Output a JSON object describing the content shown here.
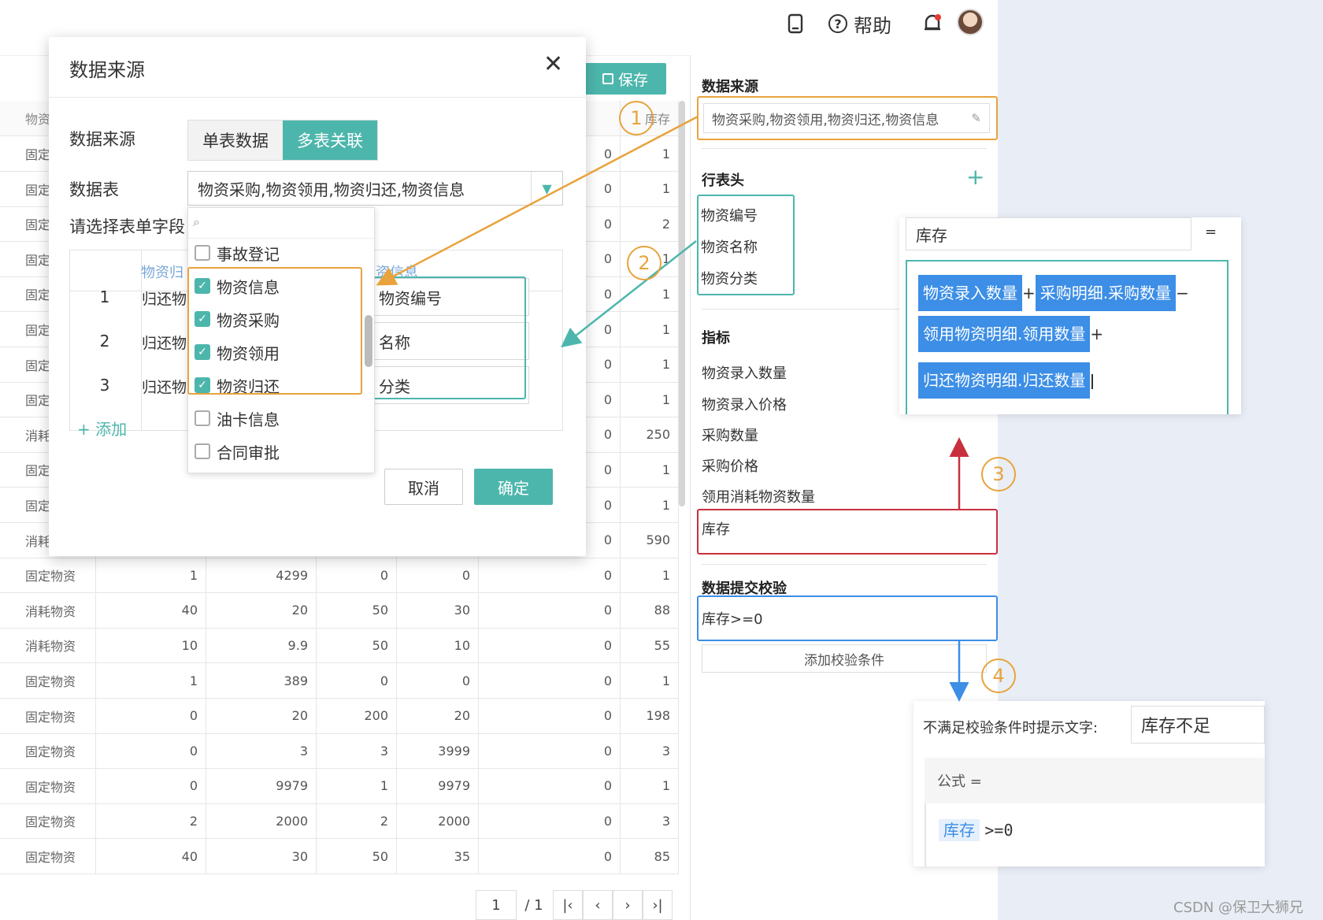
{
  "topbar": {
    "help_label": "帮助"
  },
  "toolbar": {
    "save_label": "保存"
  },
  "table": {
    "header": [
      "物资",
      "库存"
    ],
    "rows": [
      {
        "type": "固定",
        "v1": "",
        "v2": "",
        "v3": "",
        "v4": "",
        "v5": "0",
        "stock": "1"
      },
      {
        "type": "固定",
        "v1": "",
        "v2": "",
        "v3": "",
        "v4": "",
        "v5": "0",
        "stock": "1"
      },
      {
        "type": "固定",
        "v1": "",
        "v2": "",
        "v3": "",
        "v4": "",
        "v5": "0",
        "stock": "2"
      },
      {
        "type": "固定",
        "v1": "",
        "v2": "",
        "v3": "",
        "v4": "",
        "v5": "0",
        "stock": "1"
      },
      {
        "type": "固定",
        "v1": "",
        "v2": "",
        "v3": "",
        "v4": "",
        "v5": "0",
        "stock": "1"
      },
      {
        "type": "固定",
        "v1": "",
        "v2": "",
        "v3": "",
        "v4": "",
        "v5": "0",
        "stock": "1"
      },
      {
        "type": "固定",
        "v1": "",
        "v2": "",
        "v3": "",
        "v4": "",
        "v5": "0",
        "stock": "1"
      },
      {
        "type": "固定",
        "v1": "",
        "v2": "",
        "v3": "",
        "v4": "",
        "v5": "0",
        "stock": "1"
      },
      {
        "type": "消耗",
        "v1": "",
        "v2": "",
        "v3": "",
        "v4": "",
        "v5": "0",
        "stock": "250"
      },
      {
        "type": "固定",
        "v1": "",
        "v2": "",
        "v3": "",
        "v4": "",
        "v5": "0",
        "stock": "1"
      },
      {
        "type": "固定",
        "v1": "",
        "v2": "",
        "v3": "",
        "v4": "",
        "v5": "0",
        "stock": "1"
      },
      {
        "type": "消耗",
        "v1": "",
        "v2": "",
        "v3": "",
        "v4": "",
        "v5": "0",
        "stock": "590"
      },
      {
        "type": "固定物资",
        "v1": "1",
        "v2": "4299",
        "v3": "0",
        "v4": "0",
        "v5": "0",
        "stock": "1"
      },
      {
        "type": "消耗物资",
        "v1": "40",
        "v2": "20",
        "v3": "50",
        "v4": "30",
        "v5": "0",
        "stock": "88"
      },
      {
        "type": "消耗物资",
        "v1": "10",
        "v2": "9.9",
        "v3": "50",
        "v4": "10",
        "v5": "0",
        "stock": "55"
      },
      {
        "type": "固定物资",
        "v1": "1",
        "v2": "389",
        "v3": "0",
        "v4": "0",
        "v5": "0",
        "stock": "1"
      },
      {
        "type": "固定物资",
        "v1": "0",
        "v2": "20",
        "v3": "200",
        "v4": "20",
        "v5": "0",
        "stock": "198"
      },
      {
        "type": "固定物资",
        "v1": "0",
        "v2": "3",
        "v3": "3",
        "v4": "3999",
        "v5": "0",
        "stock": "3"
      },
      {
        "type": "固定物资",
        "v1": "0",
        "v2": "9979",
        "v3": "1",
        "v4": "9979",
        "v5": "0",
        "stock": "1"
      },
      {
        "type": "固定物资",
        "v1": "2",
        "v2": "2000",
        "v3": "2",
        "v4": "2000",
        "v5": "0",
        "stock": "3"
      },
      {
        "type": "固定物资",
        "v1": "40",
        "v2": "30",
        "v3": "50",
        "v4": "35",
        "v5": "0",
        "stock": "85"
      }
    ]
  },
  "pager": {
    "page": "1",
    "total": "/ 1"
  },
  "right_panel": {
    "datasource_title": "数据来源",
    "datasource_value": "物资采购,物资领用,物资归还,物资信息",
    "row_header_title": "行表头",
    "row_headers": [
      "物资编号",
      "物资名称",
      "物资分类"
    ],
    "metrics_title": "指标",
    "metrics": [
      "物资录入数量",
      "物资录入价格",
      "采购数量",
      "采购价格",
      "领用消耗物资数量",
      "库存"
    ],
    "validation_title": "数据提交校验",
    "validation_rule": "库存>=0",
    "add_validation_label": "添加校验条件"
  },
  "dialog": {
    "title": "数据来源",
    "source_label": "数据来源",
    "seg_single": "单表数据",
    "seg_multi": "多表关联",
    "table_label": "数据表",
    "table_value": "物资采购,物资领用,物资归还,物资信息",
    "field_label": "请选择表单字段",
    "col_a": "物资归",
    "col_b": "物资信息",
    "rows": [
      {
        "num": "1",
        "a": "归还物",
        "b": "物资编号"
      },
      {
        "num": "2",
        "a": "归还物",
        "b": "名称"
      },
      {
        "num": "3",
        "a": "归还物",
        "b": "分类"
      }
    ],
    "add_label": "添加",
    "cancel_label": "取消",
    "ok_label": "确定",
    "dropdown": [
      {
        "label": "事故登记",
        "checked": false
      },
      {
        "label": "物资信息",
        "checked": true
      },
      {
        "label": "物资采购",
        "checked": true
      },
      {
        "label": "物资领用",
        "checked": true
      },
      {
        "label": "物资归还",
        "checked": true
      },
      {
        "label": "油卡信息",
        "checked": false
      },
      {
        "label": "合同审批",
        "checked": false
      }
    ]
  },
  "formula_popup": {
    "name": "库存",
    "eq": "=",
    "chips": [
      "物资录入数量",
      "采购明细.采购数量",
      "领用物资明细.领用数量",
      "归还物资明细.归还数量"
    ],
    "ops": [
      "+",
      "−",
      "+"
    ]
  },
  "validation_popup": {
    "prompt_label": "不满足校验条件时提示文字:",
    "prompt_value": "库存不足",
    "formula_label": "公式 =",
    "formula_chip": "库存",
    "formula_rest": ">=0"
  },
  "callouts": [
    "1",
    "2",
    "3",
    "4"
  ],
  "watermark": "CSDN @保卫大狮兄",
  "colors": {
    "teal": "#4db6ac",
    "orange": "#e8a33d",
    "red": "#c9303e",
    "blue": "#3c8ee6"
  }
}
